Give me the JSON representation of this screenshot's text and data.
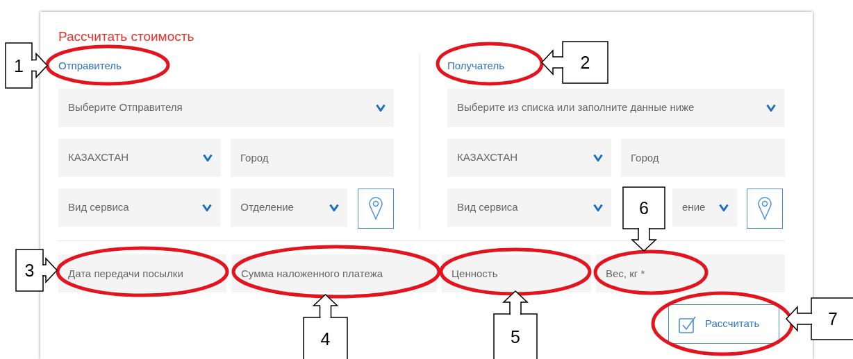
{
  "title": "Рассчитать стоимость",
  "parties": [
    {
      "label": "Отправитель",
      "select": "Выберите Отправителя",
      "country": "КАЗАХСТАН",
      "city": {
        "placeholder": "Город"
      },
      "service": "Вид сервиса",
      "branch": "Отделение"
    },
    {
      "label": "Получатель",
      "select": "Выберите из списка или заполните данные ниже",
      "country": "КАЗАХСТАН",
      "city": {
        "placeholder": "Город"
      },
      "service": "Вид сервиса",
      "branch": "ение"
    }
  ],
  "parcel_fields": [
    {
      "placeholder": "Дата передачи посылки"
    },
    {
      "placeholder": "Сумма наложенного платежа"
    },
    {
      "placeholder": "Ценность"
    },
    {
      "placeholder": "Вес, кг *"
    }
  ],
  "calculate_button": "Рассчитать",
  "annotations": [
    {
      "number": "1"
    },
    {
      "number": "2"
    },
    {
      "number": "3"
    },
    {
      "number": "4"
    },
    {
      "number": "5"
    },
    {
      "number": "6"
    },
    {
      "number": "7"
    }
  ]
}
